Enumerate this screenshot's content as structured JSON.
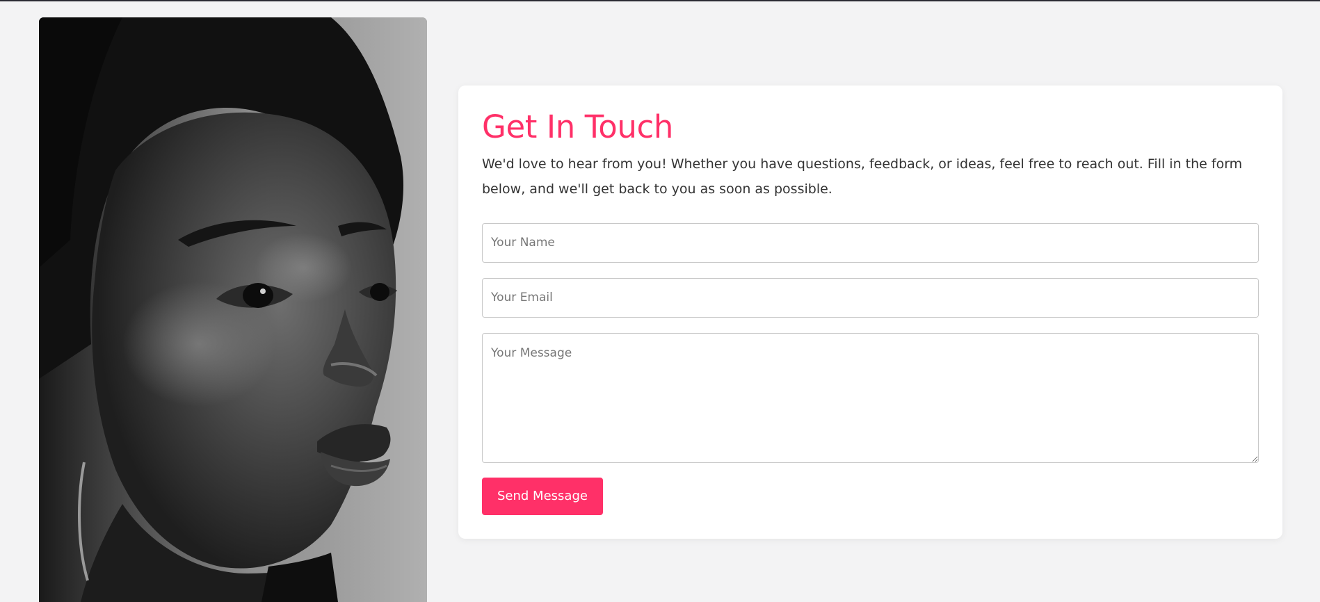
{
  "colors": {
    "accent": "#ff3068",
    "page_background": "#f3f3f4",
    "card_background": "#ffffff"
  },
  "photo": {
    "icon": "portrait-photo"
  },
  "contact": {
    "title": "Get In Touch",
    "intro": "We'd love to hear from you! Whether you have questions, feedback, or ideas, feel free to reach out. Fill in the form below, and we'll get back to you as soon as possible.",
    "name_field": {
      "placeholder": "Your Name",
      "value": ""
    },
    "email_field": {
      "placeholder": "Your Email",
      "value": ""
    },
    "message_field": {
      "placeholder": "Your Message",
      "value": ""
    },
    "send_label": "Send Message"
  }
}
